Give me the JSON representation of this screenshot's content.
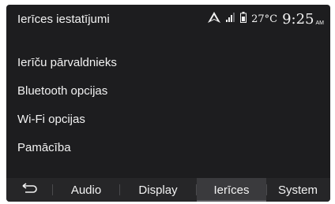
{
  "header": {
    "title": "Ierīces iestatījumi",
    "temperature": "27°C",
    "time": "9:25",
    "ampm": "AM"
  },
  "menu": {
    "items": [
      {
        "label": "Ierīču pārvaldnieks"
      },
      {
        "label": "Bluetooth opcijas"
      },
      {
        "label": "Wi-Fi opcijas"
      },
      {
        "label": "Pamācība"
      }
    ]
  },
  "tabs": {
    "audio": "Audio",
    "display": "Display",
    "ierices": "Ierīces",
    "system": "System",
    "active": "Ierīces"
  },
  "colors": {
    "background": "#1d1d1f",
    "tabbar": "#262628",
    "active_tab": "#3a3a3d",
    "text": "#f2f2f2"
  },
  "icons": [
    "navigation-arrow-icon",
    "signal-bars-icon",
    "battery-icon",
    "back-arrow-icon"
  ]
}
